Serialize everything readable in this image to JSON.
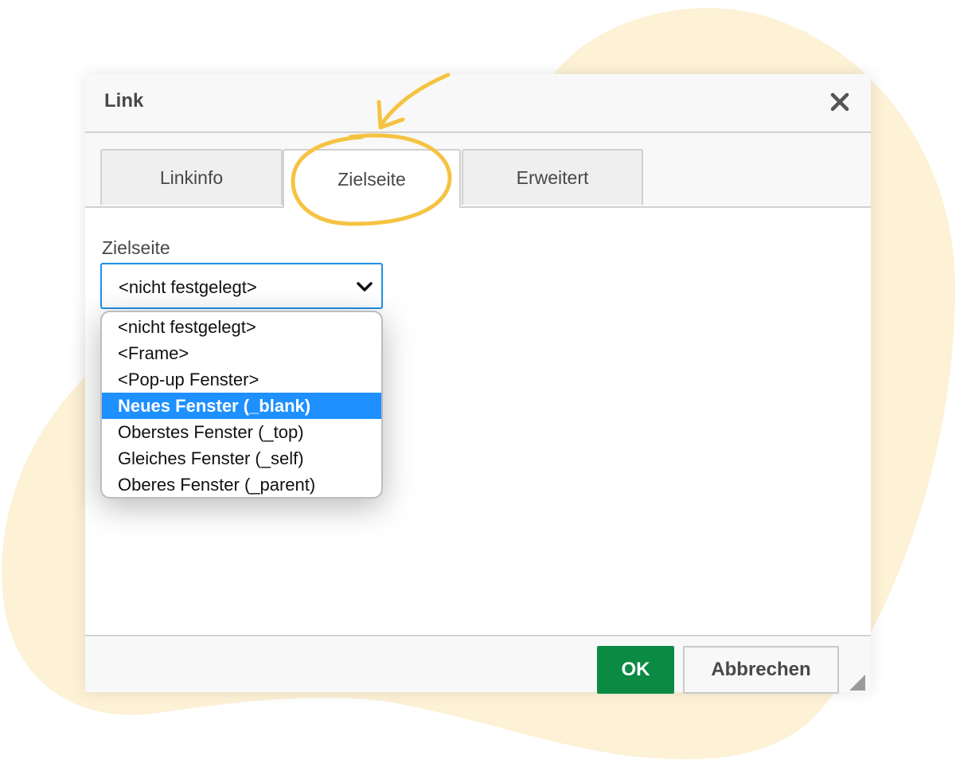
{
  "colors": {
    "background_blob": "#fdf1d6",
    "annotation": "#f5c342",
    "accent": "#1e90ff",
    "ok_button": "#0b8a43"
  },
  "dialog": {
    "title": "Link",
    "close_icon": "close-icon"
  },
  "tabs": [
    {
      "label": "Linkinfo",
      "active": false
    },
    {
      "label": "Zielseite",
      "active": true
    },
    {
      "label": "Erweitert",
      "active": false
    }
  ],
  "target_field": {
    "label": "Zielseite",
    "value": "<nicht festgelegt>",
    "expanded": true,
    "options": [
      "<nicht festgelegt>",
      "<Frame>",
      "<Pop-up Fenster>",
      "Neues Fenster (_blank)",
      "Oberstes Fenster (_top)",
      "Gleiches Fenster (_self)",
      "Oberes Fenster (_parent)"
    ],
    "highlighted_option": "Neues Fenster (_blank)"
  },
  "footer": {
    "ok_label": "OK",
    "cancel_label": "Abbrechen"
  }
}
